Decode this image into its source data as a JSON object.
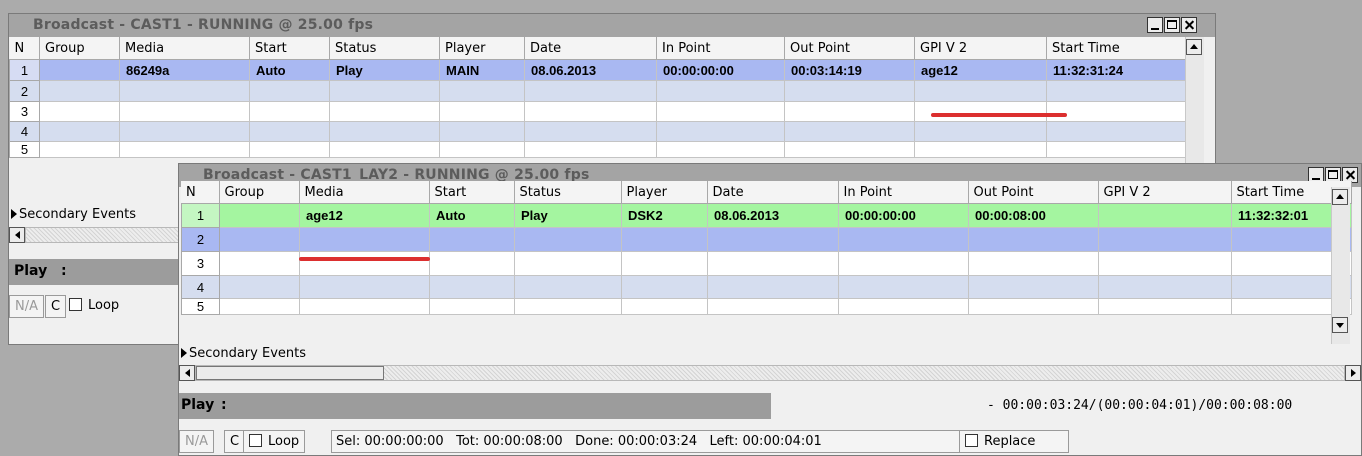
{
  "window1": {
    "title": "Broadcast - CAST1 - RUNNING @ 25.00 fps",
    "columns": [
      "N",
      "Group",
      "Media",
      "Start",
      "Status",
      "Player",
      "Date",
      "In Point",
      "Out Point",
      "GPI V 2",
      "Start Time"
    ],
    "rows": [
      [
        "1",
        "",
        "86249a",
        "Auto",
        "Play",
        "MAIN",
        "08.06.2013",
        "00:00:00:00",
        "00:03:14:19",
        "age12",
        "11:32:31:24"
      ],
      [
        "2",
        "",
        "",
        "",
        "",
        "",
        "",
        "",
        "",
        "",
        ""
      ],
      [
        "3",
        "",
        "",
        "",
        "",
        "",
        "",
        "",
        "",
        "",
        ""
      ],
      [
        "4",
        "",
        "",
        "",
        "",
        "",
        "",
        "",
        "",
        "",
        ""
      ],
      [
        "5",
        "",
        "",
        "",
        "",
        "",
        "",
        "",
        "",
        "",
        ""
      ]
    ],
    "secondary_events": "Secondary Events",
    "play_label": "Play",
    "play_colon": ":",
    "na_label": "N/A",
    "c_label": "C",
    "loop_label": "Loop",
    "highlight_colors": {
      "selected_row": "#a9b8f2",
      "underline": "#dc2f2f"
    }
  },
  "window2": {
    "title": "Broadcast - CAST1_LAY2 - RUNNING @ 25.00 fps",
    "columns": [
      "N",
      "Group",
      "Media",
      "Start",
      "Status",
      "Player",
      "Date",
      "In Point",
      "Out Point",
      "GPI V 2",
      "Start Time"
    ],
    "rows": [
      [
        "1",
        "",
        "age12",
        "Auto",
        "Play",
        "DSK2",
        "08.06.2013",
        "00:00:00:00",
        "00:00:08:00",
        "",
        "11:32:32:01"
      ],
      [
        "2",
        "",
        "",
        "",
        "",
        "",
        "",
        "",
        "",
        "",
        ""
      ],
      [
        "3",
        "",
        "",
        "",
        "",
        "",
        "",
        "",
        "",
        "",
        ""
      ],
      [
        "4",
        "",
        "",
        "",
        "",
        "",
        "",
        "",
        "",
        "",
        ""
      ],
      [
        "5",
        "",
        "",
        "",
        "",
        "",
        "",
        "",
        "",
        "",
        ""
      ]
    ],
    "secondary_events": "Secondary Events",
    "play_label": "Play",
    "play_colon": ":",
    "timecode": "- 00:00:03:24/(00:00:04:01)/00:00:08:00",
    "na_label": "N/A",
    "c_label": "C",
    "loop_label": "Loop",
    "sel": "Sel: 00:00:00:00",
    "tot": "Tot: 00:00:08:00",
    "done": "Done: 00:00:03:24",
    "left": "Left: 00:00:04:01",
    "replace_label": "Replace",
    "highlight_colors": {
      "selected_row": "#a4f5a0",
      "underline": "#dc2f2f"
    }
  }
}
